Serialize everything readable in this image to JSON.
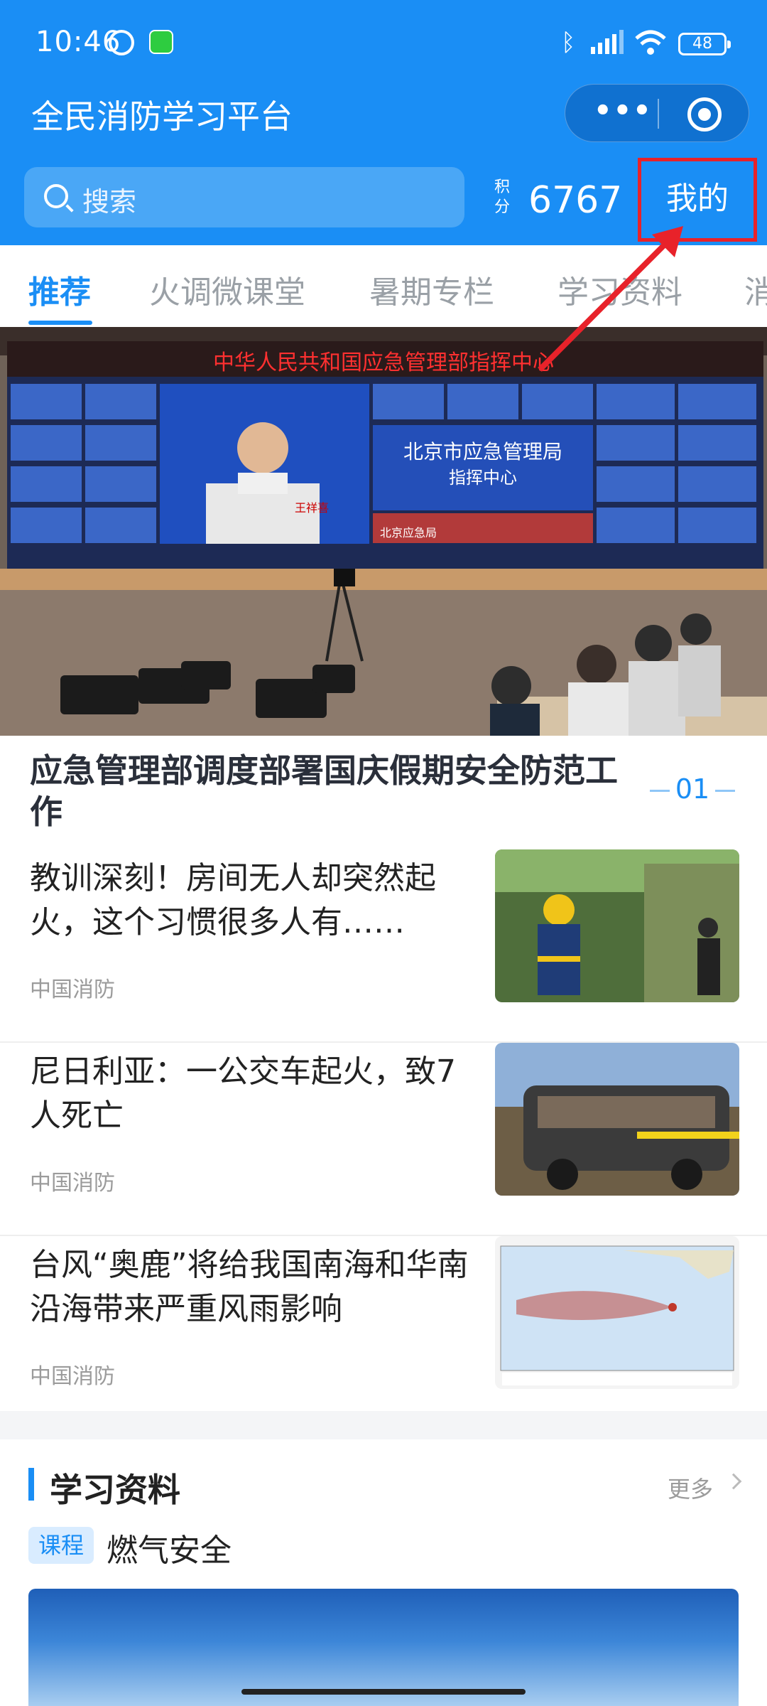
{
  "status_bar": {
    "time": "10:46",
    "battery": "48"
  },
  "header": {
    "app_title": "全民消防学习平台",
    "more_glyph": "•••",
    "search_placeholder": "搜索",
    "points_label": "积分",
    "points_value": "6767",
    "mine_label": "我的"
  },
  "tabs": [
    {
      "label": "推荐",
      "active": true
    },
    {
      "label": "火调微课堂",
      "active": false
    },
    {
      "label": "暑期专栏",
      "active": false
    },
    {
      "label": "学习资料",
      "active": false
    },
    {
      "label": "消",
      "active": false
    }
  ],
  "hero": {
    "headline": "应急管理部调度部署国庆假期安全防范工作",
    "page_index": "01",
    "screen_banner": "中华人民共和国应急管理部指挥中心",
    "screen_center_title": "北京市应急管理局",
    "screen_center_sub": "指挥中心",
    "screen_nameplate": "王祥喜",
    "screen_caption": "北京应急局"
  },
  "news": [
    {
      "title": "教训深刻！房间无人却突然起火，这个习惯很多人有……",
      "source": "中国消防",
      "thumb": "firefighter-photo"
    },
    {
      "title": "尼日利亚：一公交车起火，致7人死亡",
      "source": "中国消防",
      "thumb": "burned-bus-photo"
    },
    {
      "title": "台风“奥鹿”将给我国南海和华南沿海带来严重风雨影响",
      "source": "中国消防",
      "thumb": "typhoon-map"
    }
  ],
  "study": {
    "section_title": "学习资料",
    "more_label": "更多",
    "badge": "课程",
    "course_title": "燃气安全"
  },
  "colors": {
    "brand": "#1a8ef5",
    "annotation": "#e8222a"
  }
}
